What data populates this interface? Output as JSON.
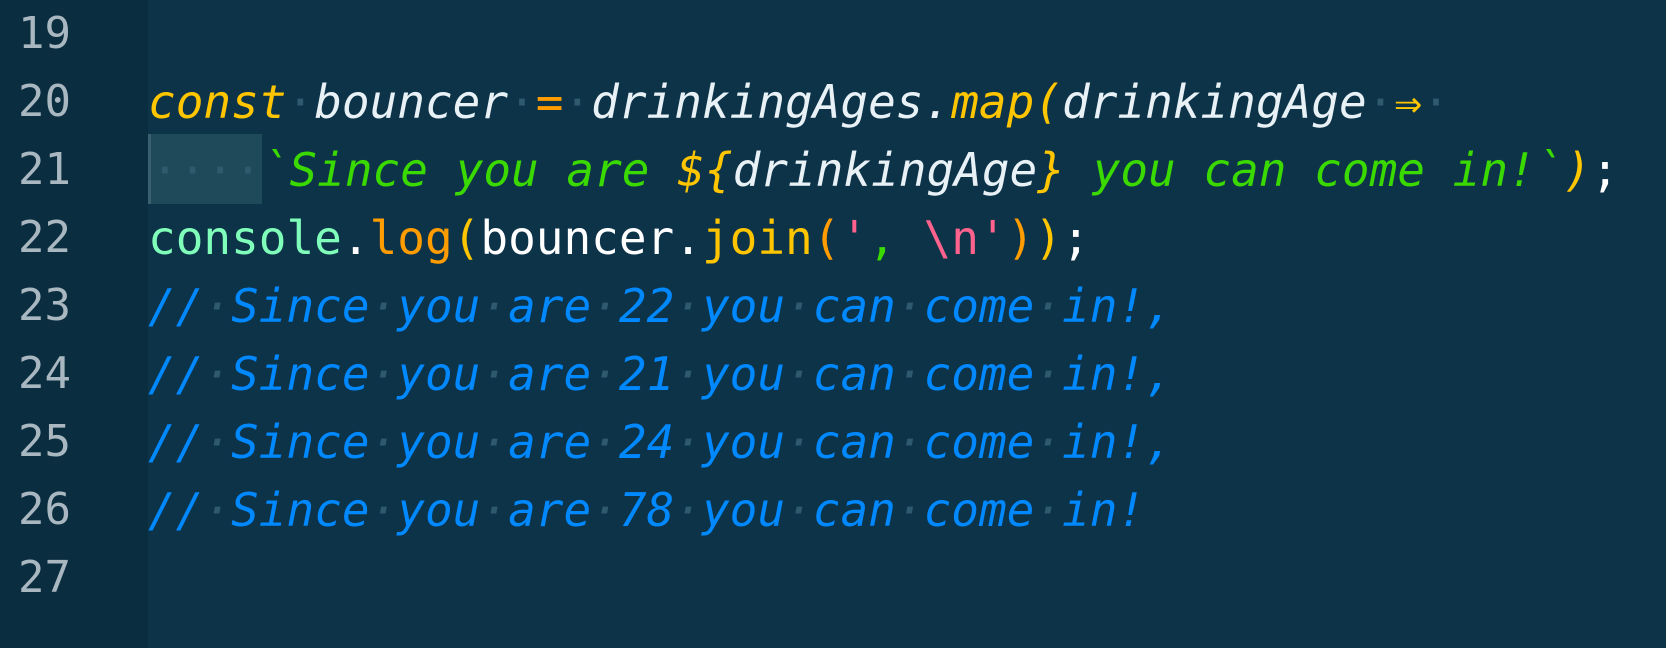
{
  "colors": {
    "background": "#0d3349",
    "gutter": "#0b2d40",
    "line_number": "#a9b8c0",
    "keyword": "#ffc600",
    "identifier": "#e8f1f5",
    "operator": "#ff9d00",
    "function_call": "#ffc600",
    "template_string": "#3ad900",
    "object": "#80ffbb",
    "method": "#ff9d00",
    "string_quote": "#ff628c",
    "escape": "#ff628c",
    "comment": "#0088ff",
    "punct": "#ffffff"
  },
  "lines": [
    {
      "number": "19"
    },
    {
      "number": "20",
      "t_const": "const",
      "t_bouncer": "bouncer",
      "t_eq": "=",
      "t_drinkingAges": "drinkingAges",
      "t_dot": ".",
      "t_map": "map",
      "t_paren": "(",
      "t_param": "drinkingAge",
      "t_arrow": "⇒"
    },
    {
      "number": "21",
      "t_indent": "····",
      "t_tpl_start": "`Since you are ",
      "t_interp_open": "${",
      "t_interp_var": "drinkingAge",
      "t_interp_close": "}",
      "t_tpl_end": " you can come in!`",
      "t_close": ")",
      "t_semi": ";"
    },
    {
      "number": "22",
      "t_console": "console",
      "t_dot": ".",
      "t_log": "log",
      "t_open": "(",
      "t_bouncer": "bouncer",
      "t_dot2": ".",
      "t_join": "join",
      "t_open2": "(",
      "t_q1": "'",
      "t_comma": ", ",
      "t_esc": "\\n",
      "t_q2": "'",
      "t_close2": ")",
      "t_close": ")",
      "t_semi": ";"
    },
    {
      "number": "23",
      "comment": "// Since you are 22 you can come in!,"
    },
    {
      "number": "24",
      "comment": "// Since you are 21 you can come in!,"
    },
    {
      "number": "25",
      "comment": "// Since you are 24 you can come in!,"
    },
    {
      "number": "26",
      "comment": "// Since you are 78 you can come in!"
    },
    {
      "number": "27"
    }
  ]
}
